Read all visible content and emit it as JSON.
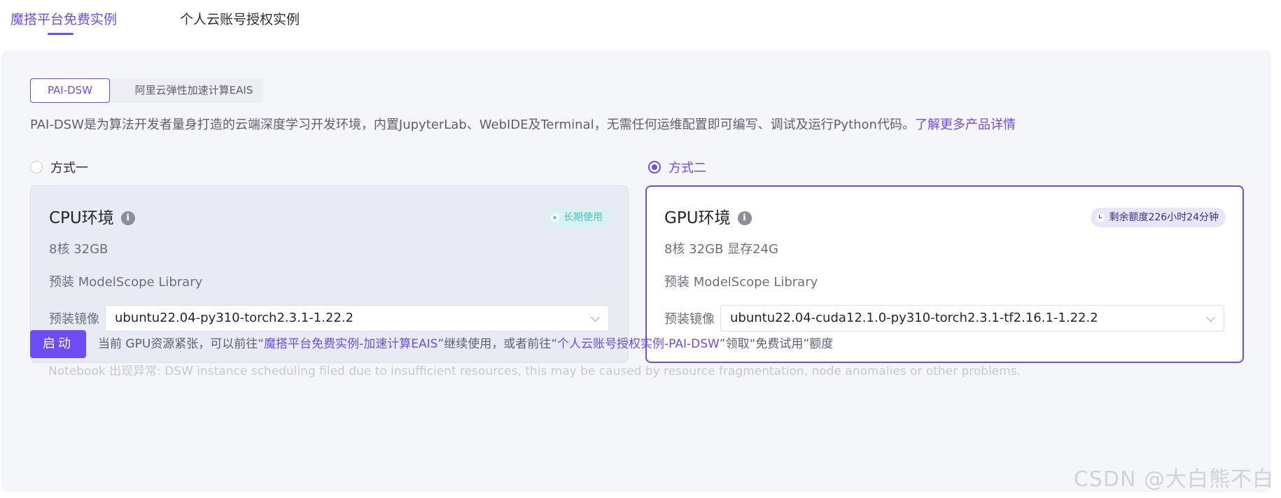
{
  "top_tabs": [
    {
      "label": "魔搭平台免费实例",
      "active": true
    },
    {
      "label": "个人云账号授权实例",
      "active": false
    }
  ],
  "segment": {
    "options": [
      "PAI-DSW",
      "阿里云弹性加速计算EAIS"
    ],
    "selected": "PAI-DSW"
  },
  "description": {
    "text": "PAI-DSW是为算法开发者量身打造的云端深度学习开发环境，内置JupyterLab、WebIDE及Terminal，无需任何运维配置即可编写、调试及运行Python代码。",
    "link": "了解更多产品详情"
  },
  "options": [
    {
      "radio_label": "方式一",
      "checked": false,
      "title": "CPU环境",
      "info_icon": "i",
      "badge": "长期使用",
      "spec": "8核 32GB",
      "library": "预装 ModelScope Library",
      "image_label": "预装镜像",
      "image_value": "ubuntu22.04-py310-torch2.3.1-1.22.2"
    },
    {
      "radio_label": "方式二",
      "checked": true,
      "title": "GPU环境",
      "info_icon": "i",
      "badge": "剩余额度226小时24分钟",
      "spec": "8核 32GB 显存24G",
      "library": "预装 ModelScope Library",
      "image_label": "预装镜像",
      "image_value": "ubuntu22.04-cuda12.1.0-py310-torch2.3.1-tf2.16.1-1.22.2"
    }
  ],
  "start_button": "启动",
  "notice": {
    "part1": "当前 GPU资源紧张，可以前往",
    "link1": "“魔搭平台免费实例-加速计算EAIS”",
    "part2": "继续使用，或者前往",
    "link2": "“个人云账号授权实例-PAI-DSW”",
    "part3": "领取“免费试用”额度"
  },
  "error_text": "Notebook 出现异常: DSW instance scheduling filed due to insufficient resources, this may be caused by resource fragmentation, node anomalies or other problems.",
  "watermark": "CSDN @大白熊不白",
  "colors": {
    "accent": "#6c4cf6",
    "panel_bg": "#f5f6fa",
    "cpu_badge": "#4cc0c0"
  }
}
